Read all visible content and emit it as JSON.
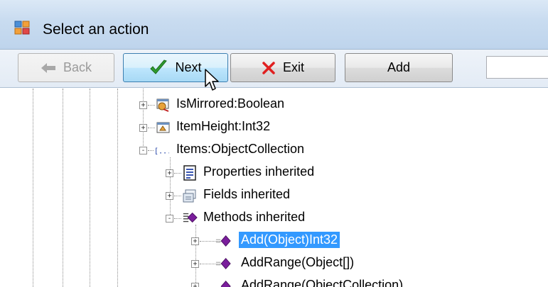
{
  "window": {
    "title": "Select an action",
    "title_icon": "app-form-icon"
  },
  "toolbar": {
    "back_label": "Back",
    "back_icon": "back-arrow-icon",
    "back_enabled": false,
    "next_label": "Next",
    "next_icon": "green-check-icon",
    "exit_label": "Exit",
    "exit_icon": "red-x-icon",
    "add_label": "Add",
    "search_value": ""
  },
  "tree": {
    "nodes": [
      {
        "label": "IsMirrored:Boolean",
        "icon": "property-icon",
        "expander": "+",
        "selected": false
      },
      {
        "label": "ItemHeight:Int32",
        "icon": "property-icon",
        "expander": "+",
        "selected": false
      },
      {
        "label": "Items:ObjectCollection",
        "icon": "bracket-collection-icon",
        "expander": "-",
        "selected": false
      },
      {
        "label": "Properties inherited",
        "icon": "properties-list-icon",
        "expander": "+",
        "selected": false
      },
      {
        "label": "Fields inherited",
        "icon": "fields-icon",
        "expander": "+",
        "selected": false
      },
      {
        "label": "Methods inherited",
        "icon": "methods-icon",
        "expander": "-",
        "selected": false
      },
      {
        "label": "Add(Object)Int32",
        "icon": "method-icon",
        "expander": "+",
        "selected": true
      },
      {
        "label": "AddRange(Object[])",
        "icon": "method-icon",
        "expander": "+",
        "selected": false
      },
      {
        "label": "AddRange(ObjectCollection)",
        "icon": "method-icon",
        "expander": "+",
        "selected": false
      }
    ]
  },
  "colors": {
    "selection": "#3399ff",
    "method_purple": "#7a1e9c",
    "next_check_green": "#2f9e2f",
    "exit_x_red": "#e02020"
  }
}
